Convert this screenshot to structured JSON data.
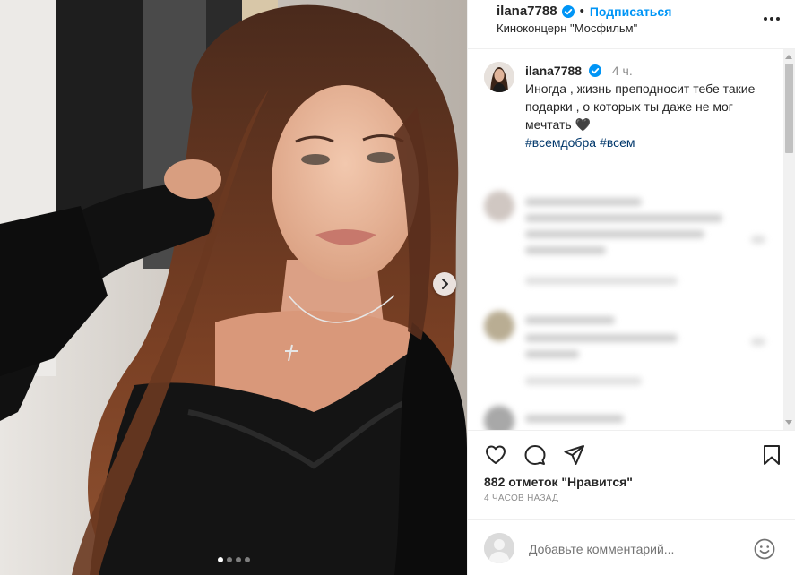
{
  "post": {
    "username": "ilana7788",
    "verified": true,
    "follow_label": "Подписаться",
    "separator": "•",
    "location": "Киноконцерн \"Мосфильм\""
  },
  "caption": {
    "username": "ilana7788",
    "time": "4 ч.",
    "text": "Иногда , жизнь преподносит тебе такие подарки , о которых ты даже не мог мечтать 🖤",
    "hashtags": [
      "#всемдобра",
      "#всем"
    ]
  },
  "carousel": {
    "count": 4,
    "active": 1
  },
  "icons": {
    "more": "more-options-icon",
    "verified": "verified-badge-icon",
    "like": "heart-icon",
    "comment": "comment-bubble-icon",
    "share": "paper-plane-icon",
    "save": "bookmark-icon",
    "emoji": "emoji-smile-icon",
    "next": "chevron-right-icon"
  },
  "stats": {
    "likes_text": "882 отметок \"Нравится\"",
    "time_ago": "4 ЧАСОВ НАЗАД"
  },
  "comment_box": {
    "placeholder": "Добавьте комментарий..."
  },
  "colors": {
    "accent": "#0095f6",
    "hashtag": "#00376b",
    "muted": "#8e8e8e",
    "border": "#efefef"
  }
}
